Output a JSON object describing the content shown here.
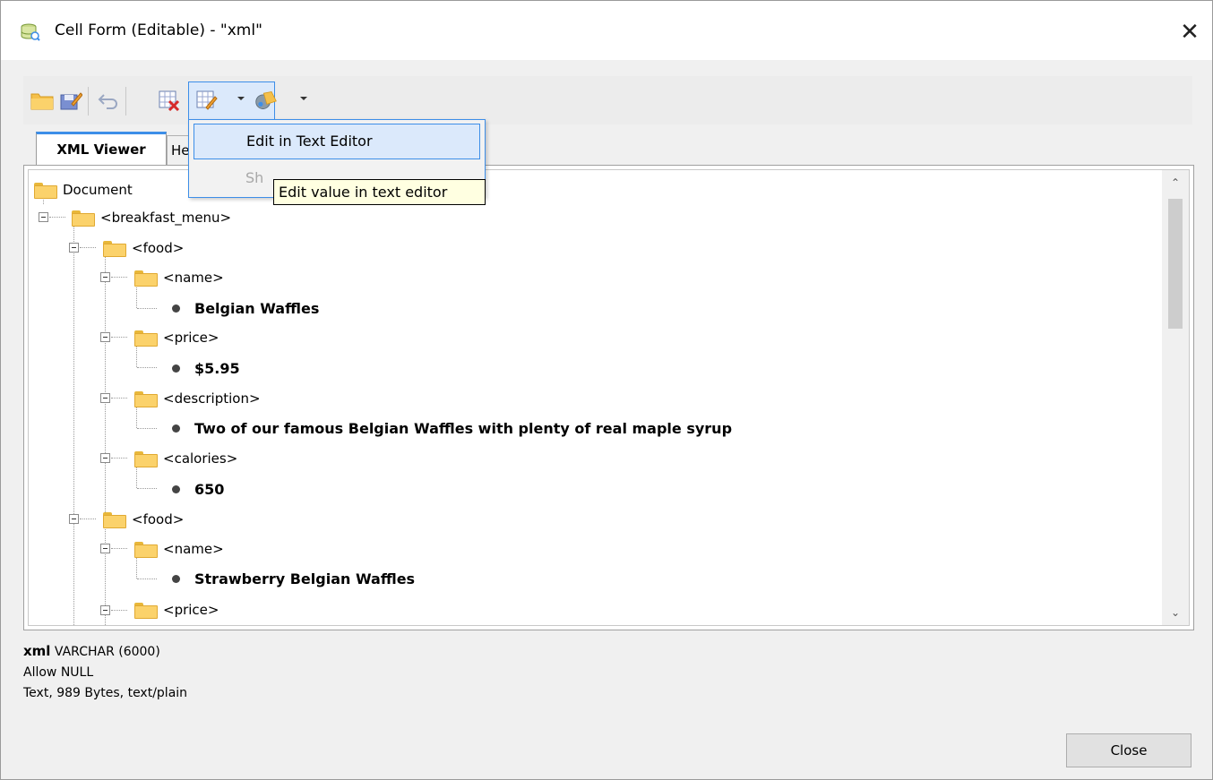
{
  "window": {
    "title": "Cell Form (Editable) - \"xml\"",
    "close_glyph": "✕"
  },
  "toolbar": {
    "icons": [
      "open-folder-icon",
      "save-icon",
      "undo-icon",
      "clear-cell-icon",
      "edit-cell-icon",
      "load-image-icon"
    ]
  },
  "tabs": [
    {
      "label": "XML Viewer"
    },
    {
      "label": "He"
    }
  ],
  "dropdown": {
    "items": [
      {
        "label": "Edit in Text Editor"
      },
      {
        "label": "Show in XML Viewer"
      }
    ],
    "visible_item2": "Sh"
  },
  "tooltip": "Edit value in text editor",
  "tree": {
    "root": "Document",
    "nodes": [
      {
        "tag": "<breakfast_menu>"
      },
      {
        "tag": "<food>"
      },
      {
        "tag": "<name>"
      },
      {
        "value": "Belgian Waffles"
      },
      {
        "tag": "<price>"
      },
      {
        "value": "$5.95"
      },
      {
        "tag": "<description>"
      },
      {
        "value": "Two of our famous Belgian Waffles with plenty of real maple syrup"
      },
      {
        "tag": "<calories>"
      },
      {
        "value": "650"
      },
      {
        "tag": "<food>"
      },
      {
        "tag": "<name>"
      },
      {
        "value": "Strawberry Belgian Waffles"
      },
      {
        "tag": "<price>"
      }
    ]
  },
  "info": {
    "column_name": "xml",
    "column_type": "VARCHAR (6000)",
    "nullability": "Allow NULL",
    "content_info": "Text, 989 Bytes, text/plain"
  },
  "footer": {
    "close_label": "Close"
  },
  "colors": {
    "accent": "#3d8ee8",
    "folder": "#fbd26b",
    "tooltip_bg": "#ffffe1"
  }
}
